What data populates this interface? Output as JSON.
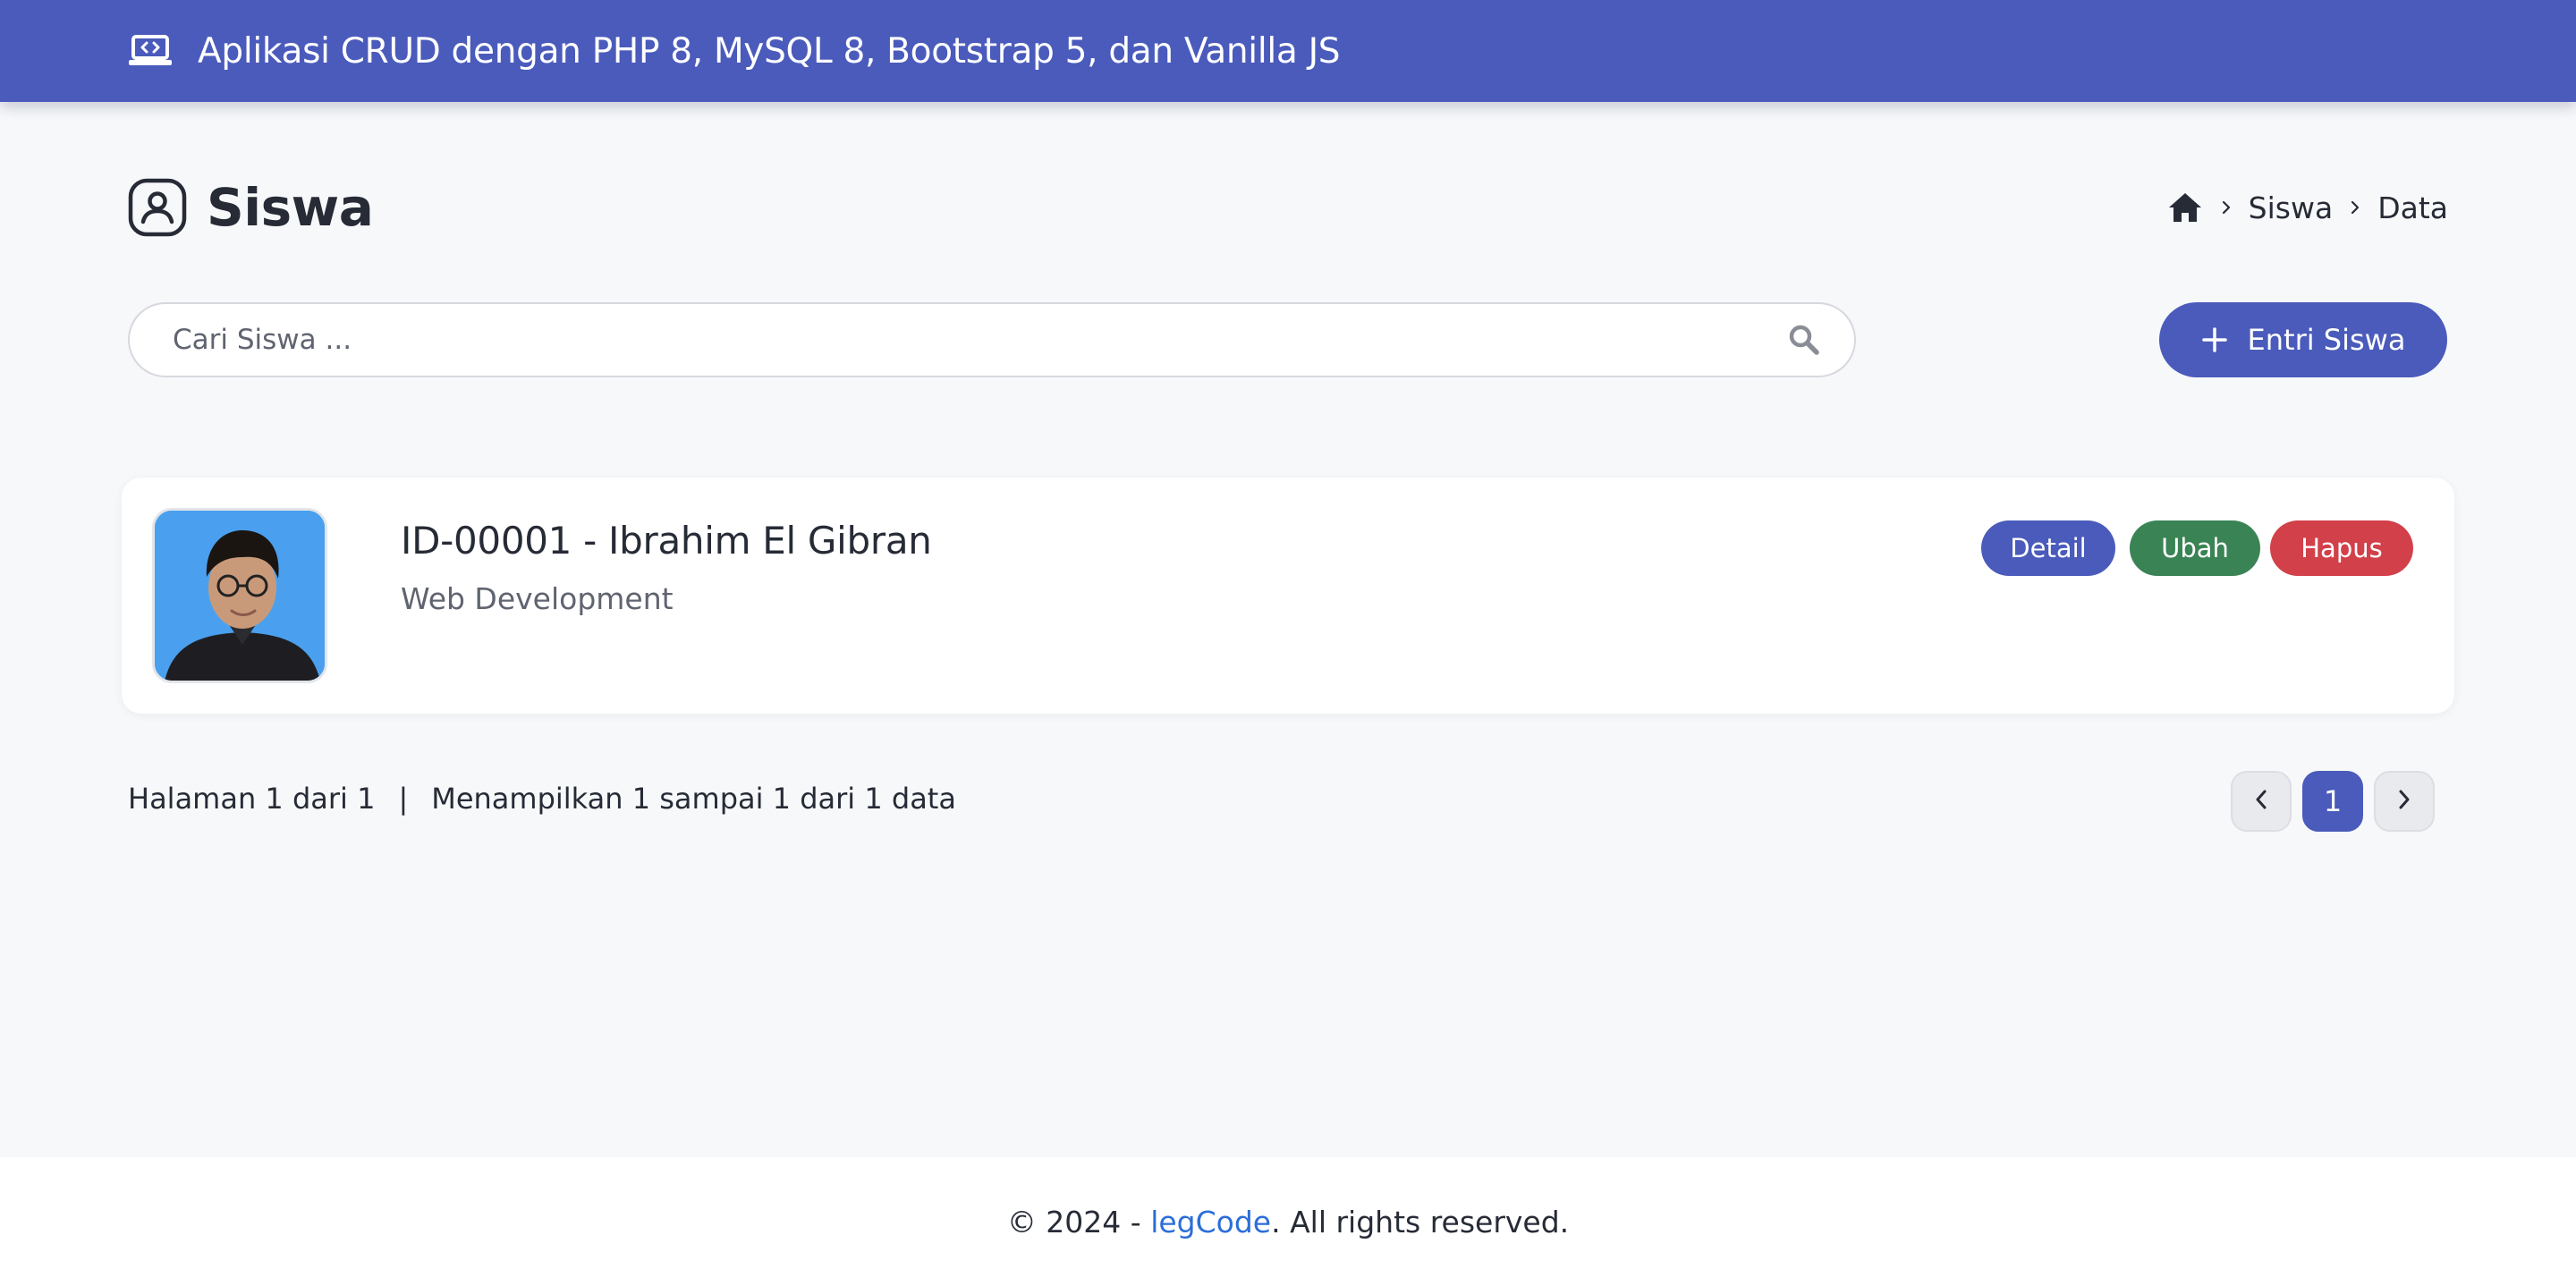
{
  "navbar": {
    "title": "Aplikasi CRUD dengan PHP 8, MySQL 8, Bootstrap 5, dan Vanilla JS",
    "icon": "laptop-code-icon"
  },
  "page": {
    "title": "Siswa",
    "icon": "user-circle-icon"
  },
  "breadcrumb": {
    "home_icon": "home-icon",
    "items": [
      "Siswa",
      "Data"
    ]
  },
  "search": {
    "placeholder": "Cari Siswa ...",
    "value": "",
    "icon": "search-icon"
  },
  "add_button": {
    "label": "Entri Siswa",
    "icon": "plus-icon"
  },
  "students": [
    {
      "title": "ID-00001 - Ibrahim El Gibran",
      "program": "Web Development",
      "photo_icon": "student-photo",
      "actions": {
        "detail": "Detail",
        "edit": "Ubah",
        "delete": "Hapus"
      }
    }
  ],
  "pagination": {
    "page_info": "Halaman 1 dari 1",
    "separator": "|",
    "range_info": "Menampilkan 1 sampai 1 dari 1 data",
    "current_page": "1",
    "prev_icon": "chevron-left-icon",
    "next_icon": "chevron-right-icon"
  },
  "footer": {
    "prefix": "© 2024 - ",
    "brand": "legCode",
    "suffix": ". All rights reserved."
  },
  "colors": {
    "primary": "#4a5bbb",
    "success": "#3a8355",
    "danger": "#d2404a",
    "link": "#2c6ed9",
    "background": "#f7f8fa"
  }
}
